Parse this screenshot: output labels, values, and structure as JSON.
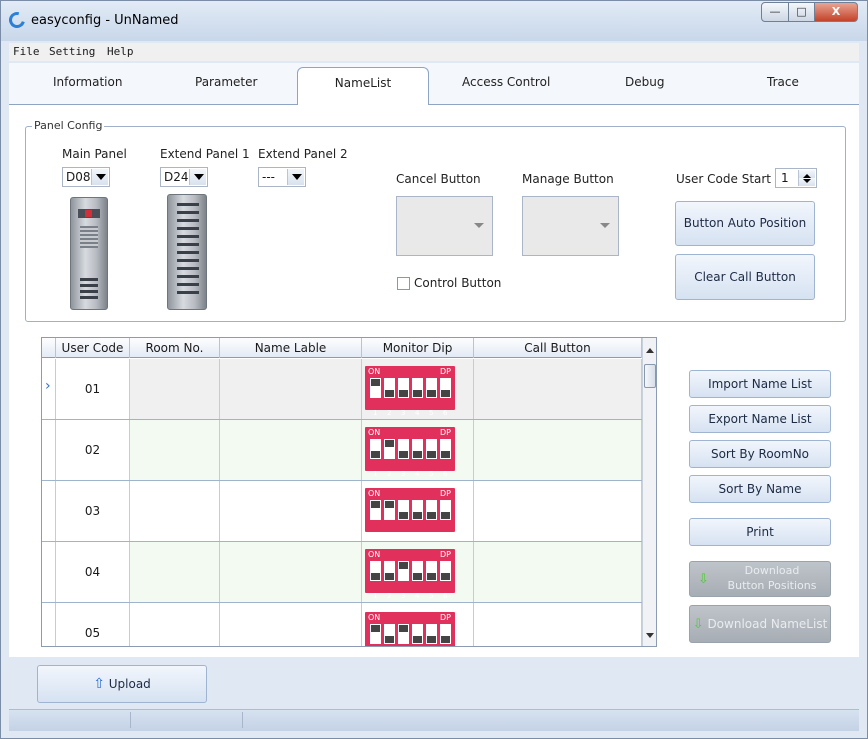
{
  "window": {
    "title": "easyconfig - UnNamed",
    "min_glyph": "—",
    "max_glyph": "□",
    "close_glyph": "X"
  },
  "menu": [
    "File",
    "Setting",
    "Help"
  ],
  "tabs": [
    "Information",
    "Parameter",
    "NameList",
    "Access Control",
    "Debug",
    "Trace"
  ],
  "active_tab": "NameList",
  "panel_config": {
    "title": "Panel Config",
    "main_panel_label": "Main Panel",
    "main_panel_value": "D08",
    "extend1_label": "Extend Panel 1",
    "extend1_value": "D24",
    "extend2_label": "Extend Panel 2",
    "extend2_value": "---",
    "cancel_button_label": "Cancel Button",
    "manage_button_label": "Manage Button",
    "control_button_label": "Control Button",
    "control_button_checked": false,
    "user_code_start_label": "User Code Start",
    "user_code_start_value": "1",
    "button_auto_position": "Button Auto Position",
    "clear_call_button": "Clear Call Button"
  },
  "grid": {
    "columns": [
      "User Code",
      "Room No.",
      "Name Lable",
      "Monitor Dip",
      "Call Button"
    ],
    "dip_on": "ON",
    "dip_dp": "DP",
    "dip_numbers": [
      "1",
      "2",
      "3",
      "4",
      "5",
      "6"
    ],
    "rows": [
      {
        "user_code": "01",
        "room_no": "",
        "name": "",
        "call_button": "",
        "dip": [
          1,
          0,
          0,
          0,
          0,
          0
        ]
      },
      {
        "user_code": "02",
        "room_no": "",
        "name": "",
        "call_button": "",
        "dip": [
          0,
          1,
          0,
          0,
          0,
          0
        ]
      },
      {
        "user_code": "03",
        "room_no": "",
        "name": "",
        "call_button": "",
        "dip": [
          1,
          1,
          0,
          0,
          0,
          0
        ]
      },
      {
        "user_code": "04",
        "room_no": "",
        "name": "",
        "call_button": "",
        "dip": [
          0,
          0,
          1,
          0,
          0,
          0
        ]
      },
      {
        "user_code": "05",
        "room_no": "",
        "name": "",
        "call_button": "",
        "dip": [
          1,
          0,
          1,
          0,
          0,
          0
        ]
      }
    ]
  },
  "side_buttons": {
    "import": "Import Name List",
    "export": "Export Name List",
    "sort_room": "Sort By RoomNo",
    "sort_name": "Sort By Name",
    "print": "Print",
    "download_positions_1": "Download",
    "download_positions_2": "Button Positions",
    "download_namelist": "Download NameList"
  },
  "upload_label": "Upload",
  "colors": {
    "dip_red": "#e2305c",
    "tab_border": "#8fa4c2",
    "row_alt": "#f3faf2",
    "row_first": "#f0f0f0"
  }
}
